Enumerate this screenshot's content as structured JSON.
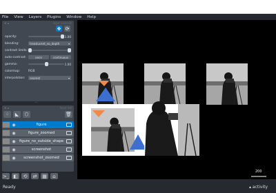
{
  "menu": [
    "File",
    "View",
    "Layers",
    "Plugins",
    "Window",
    "Help"
  ],
  "layer_controls": {
    "header_hint": "layer controls",
    "rows": [
      {
        "label": "opacity:",
        "value": "1.00",
        "fraction": 1.0
      },
      {
        "label": "blending:",
        "combo": "translucent_no_depth"
      },
      {
        "label": "contrast limits:",
        "buttons": [
          "reset",
          "continuous"
        ]
      },
      {
        "label": "auto-contrast:",
        "buttons": [
          "once",
          "continuous"
        ]
      },
      {
        "label": "gamma:",
        "value": "1.00",
        "fraction": 0.5
      },
      {
        "label": "colormap:",
        "combo": "RGB"
      },
      {
        "label": "interpolation:",
        "combo": "nearest"
      }
    ]
  },
  "layer_list": {
    "header_hint": "layer list",
    "layers": [
      {
        "name": "figure",
        "selected": true
      },
      {
        "name": "figure_zoomed",
        "selected": false
      },
      {
        "name": "figure_no_outside_shape",
        "selected": false
      },
      {
        "name": "screenshot",
        "selected": false
      },
      {
        "name": "screenshot_zoomed",
        "selected": false
      }
    ]
  },
  "scale_bar": {
    "value": "200"
  },
  "status": {
    "text": "Ready",
    "activity": "activity"
  },
  "colors": {
    "accent": "#007acc",
    "panel": "#414851",
    "bg": "#262930",
    "canvas": "#000000",
    "triangle": "#3d6fd0",
    "triangle_orange": "#f08a4b"
  }
}
